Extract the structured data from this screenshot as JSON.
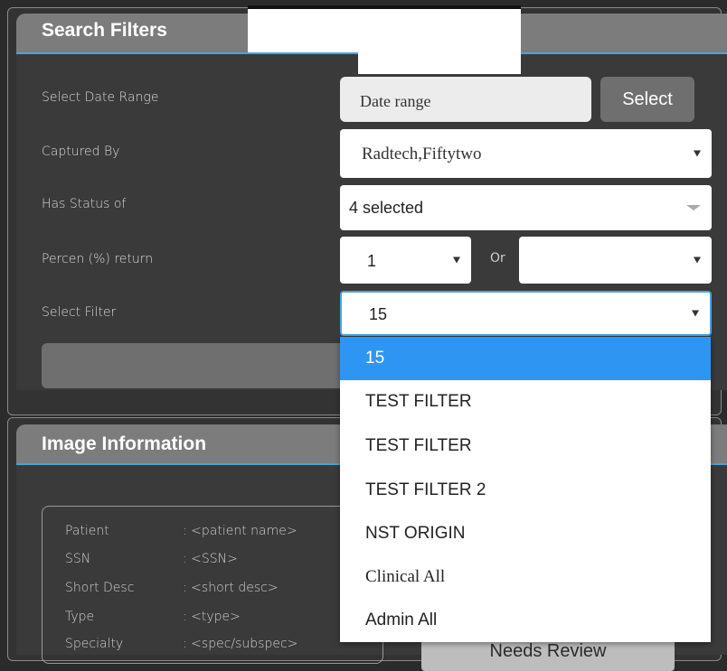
{
  "filters": {
    "title": "Search Filters",
    "rows": {
      "date_label": "Select Date Range",
      "captured_label": "Captured By",
      "status_label": "Has Status of",
      "percent_label": "Percen (%) return",
      "filter_label": "Select Filter"
    },
    "date_placeholder": "Date range",
    "select_button": "Select",
    "captured_value": "Radtech,Fiftytwo",
    "status_value": "4 selected",
    "percent_value": "1",
    "or_label": "Or",
    "or_value": "",
    "filter_value": "15"
  },
  "dropdown": {
    "items": [
      {
        "label": "15",
        "selected": true
      },
      {
        "label": "TEST FILTER",
        "selected": false
      },
      {
        "label": "TEST FILTER",
        "selected": false
      },
      {
        "label": "TEST FILTER 2",
        "selected": false
      },
      {
        "label": "NST ORIGIN",
        "selected": false
      },
      {
        "label": "Clinical All",
        "selected": false
      },
      {
        "label": "Admin All",
        "selected": false
      }
    ]
  },
  "info": {
    "title": "Image Information",
    "fields": [
      {
        "key": "Patient",
        "value": ": <patient name>"
      },
      {
        "key": "SSN",
        "value": ": <SSN>"
      },
      {
        "key": "Short Desc",
        "value": ": <short desc>"
      },
      {
        "key": "Type",
        "value": ": <type>"
      },
      {
        "key": "Specialty",
        "value": ": <spec/subspec>"
      }
    ],
    "needs_review_button": "Needs Review"
  },
  "colors": {
    "accent": "#2f95f2",
    "header": "#7c7c7c",
    "panel": "#3a3a3a"
  }
}
